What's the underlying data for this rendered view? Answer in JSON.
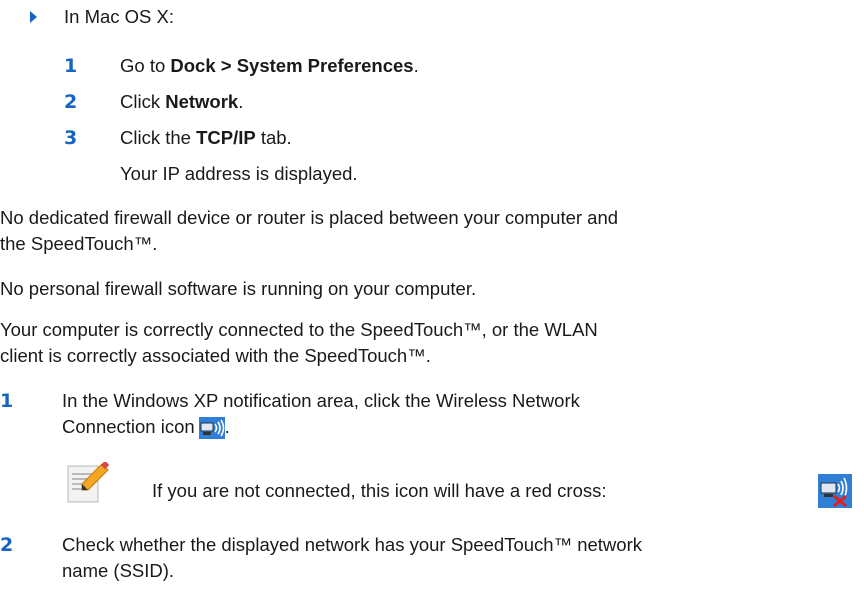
{
  "mac": {
    "intro": "In Mac OS X:",
    "steps": [
      {
        "num": "1",
        "pre": "Go to ",
        "bold": "Dock > System Preferences",
        "post": "."
      },
      {
        "num": "2",
        "pre": "Click ",
        "bold": "Network",
        "post": "."
      },
      {
        "num": "3",
        "pre": "Click the ",
        "bold": "TCP/IP",
        "post": " tab."
      }
    ],
    "result": "Your IP address is displayed."
  },
  "paragraphs": {
    "p1_line1": "No dedicated firewall device or router is placed between your computer and",
    "p1_line2": "the SpeedTouch™.",
    "p2": "No personal firewall software is running on your computer.",
    "p3_line1": "Your computer is correctly connected to the SpeedTouch™, or the WLAN",
    "p3_line2": "client is correctly associated with the SpeedTouch™."
  },
  "steps": [
    {
      "num": "1",
      "line1": "In the Windows XP notification area, click the Wireless Network",
      "line2": "Connection icon",
      "line2_post": "."
    },
    {
      "num": "2",
      "line1": "Check whether the displayed network has your SpeedTouch™ network",
      "line2": "name (SSID)."
    }
  ],
  "note": {
    "text": "If you are not connected, this icon will have a red cross:",
    "icon": "note-pencil-icon"
  },
  "icons": {
    "wireless": "wireless-network-icon",
    "wireless_disconnected": "wireless-network-disconnected-icon"
  },
  "colors": {
    "accent": "#1565c0",
    "text": "#1a1a1a",
    "error": "#e02020"
  }
}
